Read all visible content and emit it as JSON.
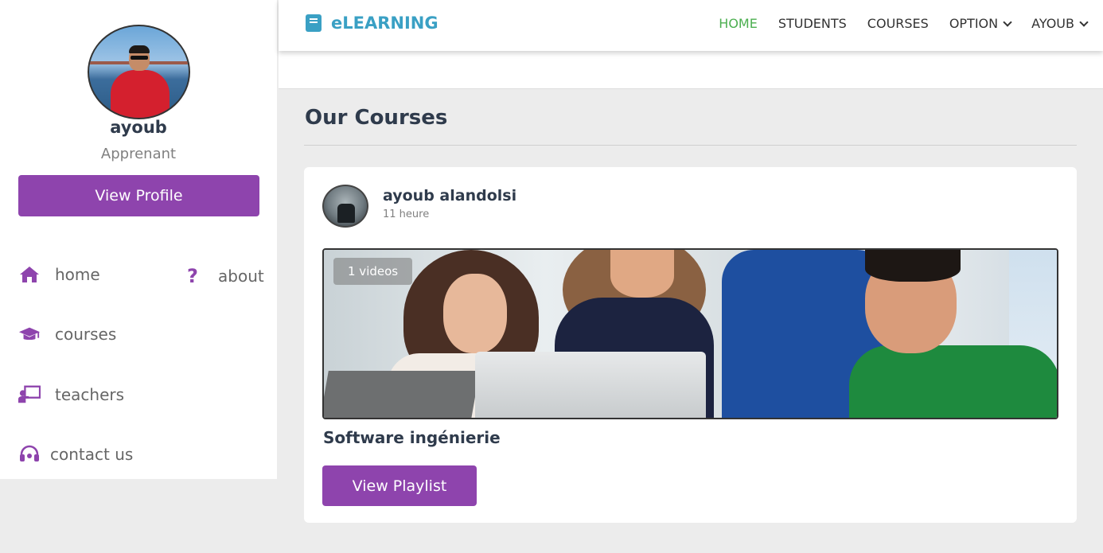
{
  "sidebar": {
    "user": {
      "name": "ayoub",
      "role": "Apprenant"
    },
    "view_profile_label": "View Profile",
    "nav": [
      {
        "label": "home",
        "icon": "home-icon"
      },
      {
        "label": "about",
        "icon": "question-icon"
      },
      {
        "label": "courses",
        "icon": "graduation-cap-icon"
      },
      {
        "label": "teachers",
        "icon": "chalkboard-teacher-icon"
      },
      {
        "label": "contact us",
        "icon": "headset-icon"
      }
    ]
  },
  "header": {
    "brand": "eLEARNING",
    "menu": [
      {
        "label": "HOME",
        "active": true
      },
      {
        "label": "STUDENTS"
      },
      {
        "label": "COURSES"
      },
      {
        "label": "OPTION",
        "dropdown": true
      },
      {
        "label": "AYOUB",
        "dropdown": true
      }
    ]
  },
  "main": {
    "section_title": "Our Courses",
    "course": {
      "author_name": "ayoub alandolsi",
      "author_time": "11 heure",
      "videos_badge": "1 videos",
      "title": "Software ingénierie",
      "button_label": "View Playlist"
    }
  },
  "colors": {
    "accent": "#8e44ad",
    "brand": "#3aa0c4",
    "nav_active": "#4caf50"
  }
}
